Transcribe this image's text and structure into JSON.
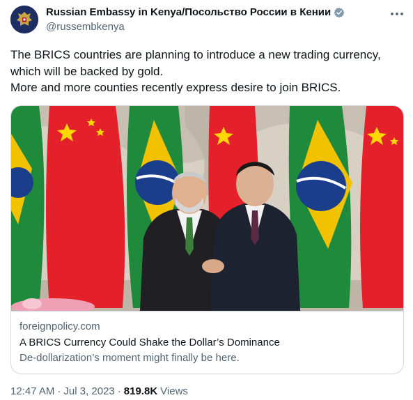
{
  "author": {
    "display_name": "Russian Embassy in Kenya/Посольство России в Кении",
    "handle": "@russembkenya",
    "avatar_icon": "coat-of-arms-icon",
    "verified_icon": "verified-badge-icon",
    "verified_color": "#829aab"
  },
  "tweet": {
    "lines": [
      "The BRICS countries are planning to introduce a new trading currency,",
      "which will be backed by gold.",
      "More and more counties recently express desire to join BRICS."
    ]
  },
  "card": {
    "domain": "foreignpolicy.com",
    "title": "A BRICS Currency Could Shake the Dollar’s Dominance",
    "description": "De-dollarization’s moment might finally be here."
  },
  "meta": {
    "time": "12:47 AM",
    "separator": "·",
    "date": "Jul 3, 2023",
    "separator2": "·",
    "views_count": "819.8K",
    "views_label": "Views"
  },
  "colors": {
    "text_primary": "#0f1419",
    "text_secondary": "#536471",
    "border": "#cfd9de"
  }
}
